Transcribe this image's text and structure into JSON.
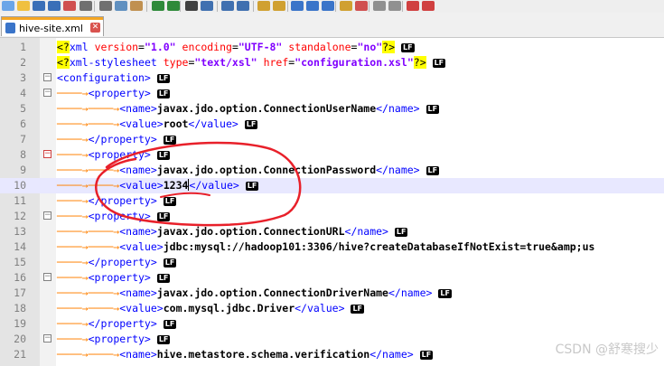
{
  "toolbar": {
    "buttons": [
      {
        "name": "new-file-icon",
        "color": "#6aa5e8"
      },
      {
        "name": "open-file-icon",
        "color": "#f0c040"
      },
      {
        "name": "save-icon",
        "color": "#3a6fb8"
      },
      {
        "name": "save-all-icon",
        "color": "#3a6fb8"
      },
      {
        "name": "close-icon",
        "color": "#d05050"
      },
      {
        "name": "print-icon",
        "color": "#707070"
      },
      {
        "name": "cut-icon",
        "color": "#707070"
      },
      {
        "name": "copy-icon",
        "color": "#6090c0"
      },
      {
        "name": "paste-icon",
        "color": "#c09050"
      },
      {
        "name": "undo-icon",
        "color": "#2f8a3a"
      },
      {
        "name": "redo-icon",
        "color": "#2f8a3a"
      },
      {
        "name": "find-icon",
        "color": "#404040"
      },
      {
        "name": "replace-icon",
        "color": "#4070b0"
      },
      {
        "name": "zoom-in-icon",
        "color": "#4070b0"
      },
      {
        "name": "zoom-out-icon",
        "color": "#4070b0"
      },
      {
        "name": "sync-v-icon",
        "color": "#d0a030"
      },
      {
        "name": "sync-h-icon",
        "color": "#d0a030"
      },
      {
        "name": "word-wrap-icon",
        "color": "#3a74c9"
      },
      {
        "name": "show-all-chars-icon",
        "color": "#3a74c9"
      },
      {
        "name": "indent-guide-icon",
        "color": "#3a74c9"
      },
      {
        "name": "udl-icon",
        "color": "#d0a030"
      },
      {
        "name": "doc-map-icon",
        "color": "#d05050"
      },
      {
        "name": "function-list-icon",
        "color": "#909090"
      },
      {
        "name": "folder-workspace-icon",
        "color": "#909090"
      },
      {
        "name": "monitoring-icon",
        "color": "#d04040"
      },
      {
        "name": "record-macro-icon",
        "color": "#d04040"
      }
    ]
  },
  "tab": {
    "label": "hive-site.xml",
    "close": "✕"
  },
  "lines": [
    {
      "n": "1",
      "fold": "",
      "segs": [
        [
          "pi",
          "<?"
        ],
        [
          "tag",
          "xml"
        ],
        [
          "sp",
          " "
        ],
        [
          "attr",
          "version"
        ],
        [
          "sp",
          "="
        ],
        [
          "str",
          "\"1.0\""
        ],
        [
          "sp",
          " "
        ],
        [
          "attr",
          "encoding"
        ],
        [
          "sp",
          "="
        ],
        [
          "str",
          "\"UTF-8\""
        ],
        [
          "sp",
          " "
        ],
        [
          "attr",
          "standalone"
        ],
        [
          "sp",
          "="
        ],
        [
          "str",
          "\"no\""
        ],
        [
          "pi",
          "?>"
        ],
        [
          "sp",
          " "
        ],
        [
          "lf",
          "LF"
        ]
      ]
    },
    {
      "n": "2",
      "fold": "",
      "segs": [
        [
          "pi",
          "<?"
        ],
        [
          "tag",
          "xml-stylesheet"
        ],
        [
          "sp",
          " "
        ],
        [
          "attr",
          "type"
        ],
        [
          "sp",
          "="
        ],
        [
          "str",
          "\"text/xsl\""
        ],
        [
          "sp",
          " "
        ],
        [
          "attr",
          "href"
        ],
        [
          "sp",
          "="
        ],
        [
          "str",
          "\"configuration.xsl\""
        ],
        [
          "pi",
          "?>"
        ],
        [
          "sp",
          " "
        ],
        [
          "lf",
          "LF"
        ]
      ]
    },
    {
      "n": "3",
      "fold": "−",
      "segs": [
        [
          "tag",
          "<configuration>"
        ],
        [
          "sp",
          " "
        ],
        [
          "lf",
          "LF"
        ]
      ]
    },
    {
      "n": "4",
      "fold": "−",
      "segs": [
        [
          "ind",
          "────→"
        ],
        [
          "tag",
          "<property>"
        ],
        [
          "sp",
          " "
        ],
        [
          "lf",
          "LF"
        ]
      ]
    },
    {
      "n": "5",
      "fold": "",
      "segs": [
        [
          "ind",
          "────→────→"
        ],
        [
          "tag",
          "<name>"
        ],
        [
          "txt",
          "javax.jdo.option.ConnectionUserName"
        ],
        [
          "tag",
          "</name>"
        ],
        [
          "sp",
          " "
        ],
        [
          "lf",
          "LF"
        ]
      ]
    },
    {
      "n": "6",
      "fold": "",
      "segs": [
        [
          "ind",
          "────→────→"
        ],
        [
          "tag",
          "<value>"
        ],
        [
          "txt",
          "root"
        ],
        [
          "tag",
          "</value>"
        ],
        [
          "sp",
          " "
        ],
        [
          "lf",
          "LF"
        ]
      ]
    },
    {
      "n": "7",
      "fold": "",
      "segs": [
        [
          "ind",
          "────→"
        ],
        [
          "tag",
          "</property>"
        ],
        [
          "sp",
          " "
        ],
        [
          "lf",
          "LF"
        ]
      ]
    },
    {
      "n": "8",
      "fold": "−",
      "red": true,
      "segs": [
        [
          "ind",
          "────→"
        ],
        [
          "tag",
          "<property>"
        ],
        [
          "sp",
          " "
        ],
        [
          "lf",
          "LF"
        ]
      ]
    },
    {
      "n": "9",
      "fold": "",
      "segs": [
        [
          "ind",
          "────→────→"
        ],
        [
          "tag",
          "<name>"
        ],
        [
          "txt",
          "javax.jdo.option.ConnectionPassword"
        ],
        [
          "tag",
          "</name>"
        ],
        [
          "sp",
          " "
        ],
        [
          "lf",
          "LF"
        ]
      ]
    },
    {
      "n": "10",
      "fold": "",
      "current": true,
      "segs": [
        [
          "ind",
          "────→────→"
        ],
        [
          "tag",
          "<value>"
        ],
        [
          "txt",
          "1234"
        ],
        [
          "caret",
          ""
        ],
        [
          "tag",
          "</value>"
        ],
        [
          "sp",
          " "
        ],
        [
          "lf",
          "LF"
        ]
      ]
    },
    {
      "n": "11",
      "fold": "",
      "segs": [
        [
          "ind",
          "────→"
        ],
        [
          "tag",
          "</property>"
        ],
        [
          "sp",
          " "
        ],
        [
          "lf",
          "LF"
        ]
      ]
    },
    {
      "n": "12",
      "fold": "−",
      "segs": [
        [
          "ind",
          "────→"
        ],
        [
          "tag",
          "<property>"
        ],
        [
          "sp",
          " "
        ],
        [
          "lf",
          "LF"
        ]
      ]
    },
    {
      "n": "13",
      "fold": "",
      "segs": [
        [
          "ind",
          "────→────→"
        ],
        [
          "tag",
          "<name>"
        ],
        [
          "txt",
          "javax.jdo.option.ConnectionURL"
        ],
        [
          "tag",
          "</name>"
        ],
        [
          "sp",
          " "
        ],
        [
          "lf",
          "LF"
        ]
      ]
    },
    {
      "n": "14",
      "fold": "",
      "segs": [
        [
          "ind",
          "────→────→"
        ],
        [
          "tag",
          "<value>"
        ],
        [
          "txt",
          "jdbc:mysql://hadoop101:3306/hive?createDatabaseIfNotExist=true&amp;us"
        ]
      ]
    },
    {
      "n": "15",
      "fold": "",
      "segs": [
        [
          "ind",
          "────→"
        ],
        [
          "tag",
          "</property>"
        ],
        [
          "sp",
          " "
        ],
        [
          "lf",
          "LF"
        ]
      ]
    },
    {
      "n": "16",
      "fold": "−",
      "segs": [
        [
          "ind",
          "────→"
        ],
        [
          "tag",
          "<property>"
        ],
        [
          "sp",
          " "
        ],
        [
          "lf",
          "LF"
        ]
      ]
    },
    {
      "n": "17",
      "fold": "",
      "segs": [
        [
          "ind",
          "────→────→"
        ],
        [
          "tag",
          "<name>"
        ],
        [
          "txt",
          "javax.jdo.option.ConnectionDriverName"
        ],
        [
          "tag",
          "</name>"
        ],
        [
          "sp",
          " "
        ],
        [
          "lf",
          "LF"
        ]
      ]
    },
    {
      "n": "18",
      "fold": "",
      "segs": [
        [
          "ind",
          "────→────→"
        ],
        [
          "tag",
          "<value>"
        ],
        [
          "txt",
          "com.mysql.jdbc.Driver"
        ],
        [
          "tag",
          "</value>"
        ],
        [
          "sp",
          " "
        ],
        [
          "lf",
          "LF"
        ]
      ]
    },
    {
      "n": "19",
      "fold": "",
      "segs": [
        [
          "ind",
          "────→"
        ],
        [
          "tag",
          "</property>"
        ],
        [
          "sp",
          " "
        ],
        [
          "lf",
          "LF"
        ]
      ]
    },
    {
      "n": "20",
      "fold": "−",
      "segs": [
        [
          "ind",
          "────→"
        ],
        [
          "tag",
          "<property>"
        ],
        [
          "sp",
          " "
        ],
        [
          "lf",
          "LF"
        ]
      ]
    },
    {
      "n": "21",
      "fold": "",
      "segs": [
        [
          "ind",
          "────→────→"
        ],
        [
          "tag",
          "<name>"
        ],
        [
          "txt",
          "hive.metastore.schema.verification"
        ],
        [
          "tag",
          "</name>"
        ],
        [
          "sp",
          " "
        ],
        [
          "lf",
          "LF"
        ]
      ]
    }
  ],
  "annotation": {
    "color": "#e8202a"
  },
  "watermark": "CSDN @舒寒搜少"
}
